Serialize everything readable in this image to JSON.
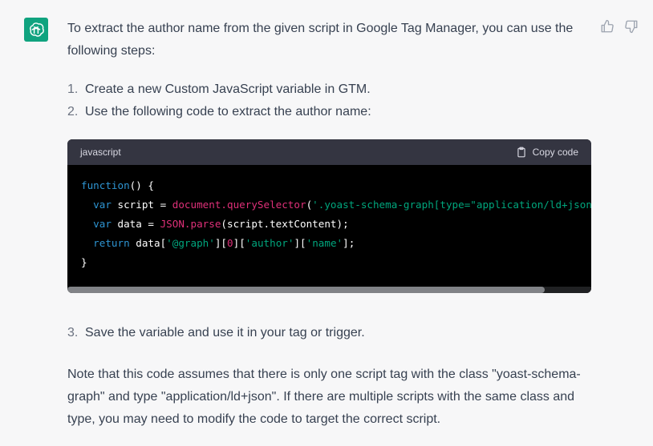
{
  "assistant": {
    "avatar_icon": "openai-logo-icon",
    "avatar_color": "#10a37f"
  },
  "message": {
    "intro": "To extract the author name from the given script in Google Tag Manager, you can use the following steps:",
    "steps": [
      {
        "num": "1.",
        "text": "Create a new Custom JavaScript variable in GTM."
      },
      {
        "num": "2.",
        "text": "Use the following code to extract the author name:"
      },
      {
        "num": "3.",
        "text": "Save the variable and use it in your tag or trigger."
      }
    ],
    "code": {
      "language": "javascript",
      "copy_label": "Copy code",
      "lines": {
        "l1_kw": "function",
        "l1_rest": "() {",
        "l2_indent": "  ",
        "l2_kw": "var",
        "l2_a": " script = ",
        "l2_fn": "document.querySelector",
        "l2_b": "(",
        "l2_str": "'.yoast-schema-graph[type=\"application/ld+json\"]'",
        "l2_c": ");",
        "l3_kw": "var",
        "l3_a": " data = ",
        "l3_fn": "JSON.parse",
        "l3_b": "(script.textContent);",
        "l4_kw": "return",
        "l4_a": " data[",
        "l4_s1": "'@graph'",
        "l4_b": "][",
        "l4_n": "0",
        "l4_c": "][",
        "l4_s2": "'author'",
        "l4_d": "][",
        "l4_s3": "'name'",
        "l4_e": "];",
        "l5": "}"
      }
    },
    "note": "Note that this code assumes that there is only one script tag with the class \"yoast-schema-graph\" and type \"application/ld+json\". If there are multiple scripts with the same class and type, you may need to modify the code to target the correct script."
  },
  "feedback": {
    "like_icon": "thumbs-up-icon",
    "dislike_icon": "thumbs-down-icon"
  }
}
